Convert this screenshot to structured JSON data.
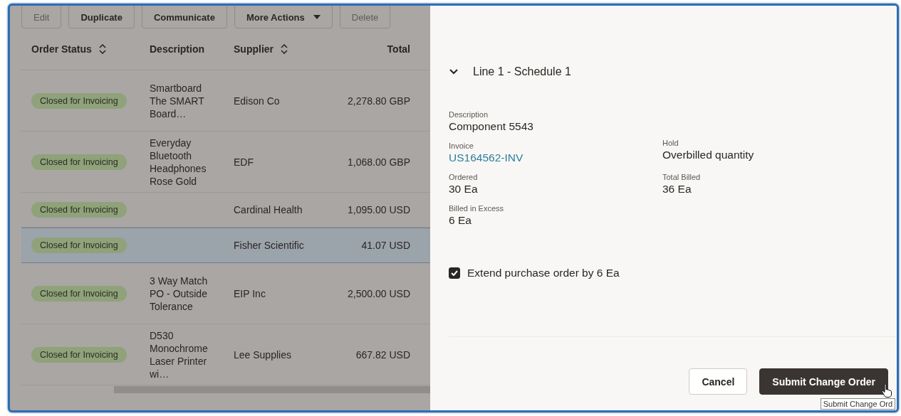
{
  "toolbar": [
    {
      "label": "Edit",
      "disabled": true,
      "kind": "plain"
    },
    {
      "label": "Duplicate",
      "disabled": false,
      "kind": "plain"
    },
    {
      "label": "Communicate",
      "disabled": false,
      "kind": "plain"
    },
    {
      "label": "More Actions",
      "disabled": false,
      "kind": "menu"
    },
    {
      "label": "Delete",
      "disabled": true,
      "kind": "plain"
    }
  ],
  "table": {
    "columns": [
      {
        "label": "Order Status",
        "sortable": true
      },
      {
        "label": "Description",
        "sortable": false
      },
      {
        "label": "Supplier",
        "sortable": true
      },
      {
        "label": "Total",
        "sortable": false
      }
    ],
    "rows": [
      {
        "status": "Closed for Invoicing",
        "description": "Smartboard The SMART Board…",
        "supplier": "Edison Co",
        "total": "2,278.80 GBP",
        "selected": false
      },
      {
        "status": "Closed for Invoicing",
        "description": "Everyday Bluetooth Headphones Rose Gold",
        "supplier": "EDF",
        "total": "1,068.00 GBP",
        "selected": false
      },
      {
        "status": "Closed for Invoicing",
        "supplier": "Cardinal Health",
        "total": "1,095.00 USD",
        "selected": false
      },
      {
        "status": "Closed for Invoicing",
        "supplier": "Fisher Scientific",
        "total": "41.07 USD",
        "selected": true
      },
      {
        "status": "Closed for Invoicing",
        "description": "3 Way Match PO - Outside Tolerance",
        "supplier": "EIP Inc",
        "total": "2,500.00 USD",
        "selected": false
      },
      {
        "status": "Closed for Invoicing",
        "description": "D530 Monochrome Laser Printer wi…",
        "supplier": "Lee Supplies",
        "total": "667.82 USD",
        "selected": false
      }
    ]
  },
  "drawer": {
    "section": {
      "title": "Line 1 - Schedule 1",
      "expanded": true
    },
    "field_rows": [
      [
        {
          "label": "Description",
          "value": "Component 5543",
          "kind": "text"
        }
      ],
      [
        {
          "label": "Invoice",
          "value": "US164562-INV",
          "kind": "link"
        },
        {
          "label": "Hold",
          "value": "Overbilled quantity",
          "kind": "text"
        }
      ],
      [
        {
          "label": "Ordered",
          "value": "30 Ea",
          "kind": "text"
        },
        {
          "label": "Total Billed",
          "value": "36 Ea",
          "kind": "text"
        }
      ],
      [
        {
          "label": "Billed in Excess",
          "value": "6 Ea",
          "kind": "text"
        }
      ]
    ],
    "checkbox": {
      "label": "Extend purchase order by 6 Ea",
      "checked": true
    },
    "buttons": [
      {
        "label": "Cancel",
        "kind": "secondary"
      },
      {
        "label": "Submit Change Order",
        "kind": "primary"
      }
    ],
    "tooltip": "Submit Change Ord"
  }
}
